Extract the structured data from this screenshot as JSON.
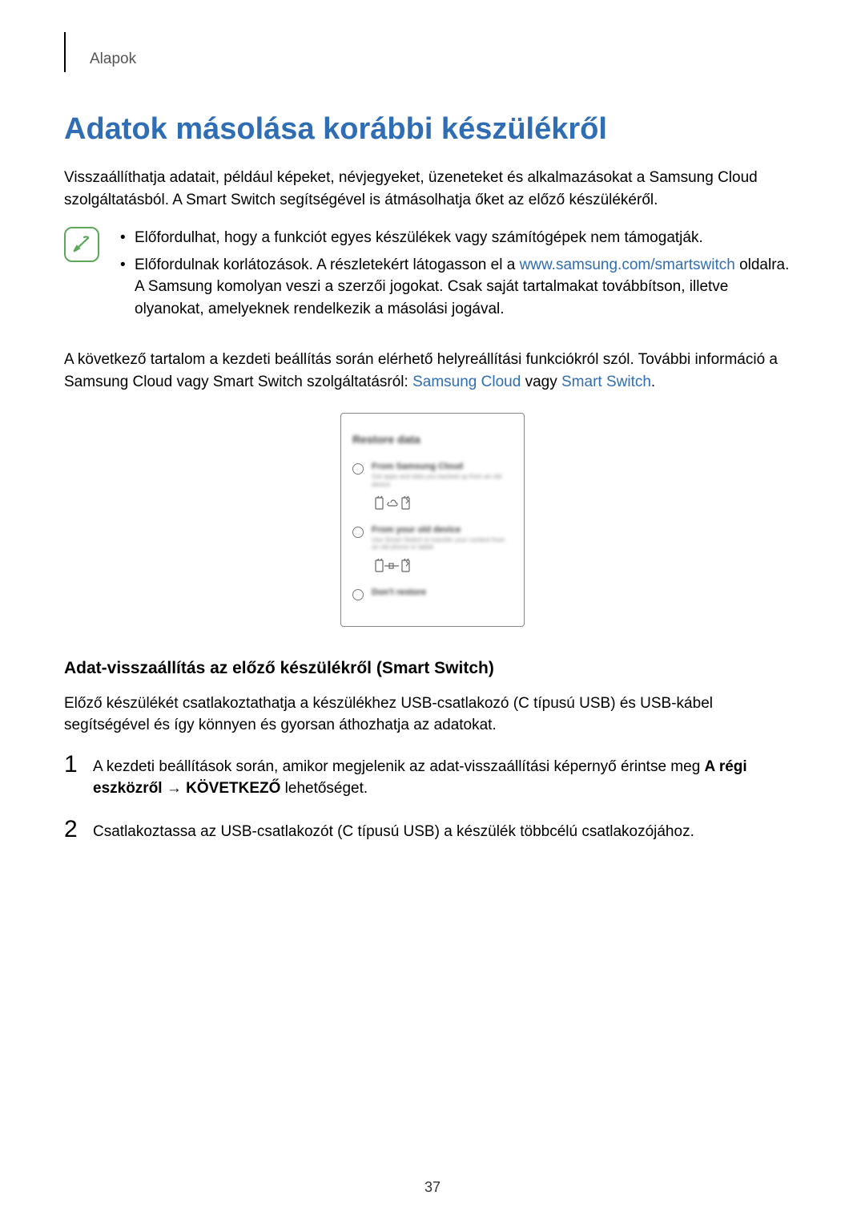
{
  "header": {
    "section": "Alapok"
  },
  "title": "Adatok másolása korábbi készülékről",
  "intro": "Visszaállíthatja adatait, például képeket, névjegyeket, üzeneteket és alkalmazásokat a Samsung Cloud szolgáltatásból. A Smart Switch segítségével is átmásolhatja őket az előző készülékéről.",
  "note": {
    "bullet1": "Előfordulhat, hogy a funkciót egyes készülékek vagy számítógépek nem támogatják.",
    "bullet2_pre": "Előfordulnak korlátozások. A részletekért látogasson el a ",
    "bullet2_link": "www.samsung.com/smartswitch",
    "bullet2_post": " oldalra. A Samsung komolyan veszi a szerzői jogokat. Csak saját tartalmakat továbbítson, illetve olyanokat, amelyeknek rendelkezik a másolási jogával."
  },
  "para2_pre": "A következő tartalom a kezdeti beállítás során elérhető helyreállítási funkciókról szól. További információ a Samsung Cloud vagy Smart Switch szolgáltatásról: ",
  "para2_link1": "Samsung Cloud",
  "para2_mid": " vagy ",
  "para2_link2": "Smart Switch",
  "para2_end": ".",
  "mock": {
    "title": "Restore data",
    "opt1_label": "From Samsung Cloud",
    "opt1_desc": "Get apps and data you backed up from an old device",
    "opt2_label": "From your old device",
    "opt2_desc": "Use Smart Switch to transfer your content from an old phone or tablet",
    "opt3_label": "Don't restore"
  },
  "subheading": "Adat-visszaállítás az előző készülékről (Smart Switch)",
  "sub_intro": "Előző készülékét csatlakoztathatja a készülékhez USB-csatlakozó (C típusú USB) és USB-kábel segítségével és így könnyen és gyorsan áthozhatja az adatokat.",
  "steps": {
    "n1": "1",
    "s1_pre": "A kezdeti beállítások során, amikor megjelenik az adat-visszaállítási képernyő érintse meg ",
    "s1_bold": "A régi eszközről → KÖVETKEZŐ",
    "s1_post": " lehetőséget.",
    "n2": "2",
    "s2": "Csatlakoztassa az USB-csatlakozót (C típusú USB) a készülék többcélú csatlakozójához."
  },
  "page_number": "37"
}
